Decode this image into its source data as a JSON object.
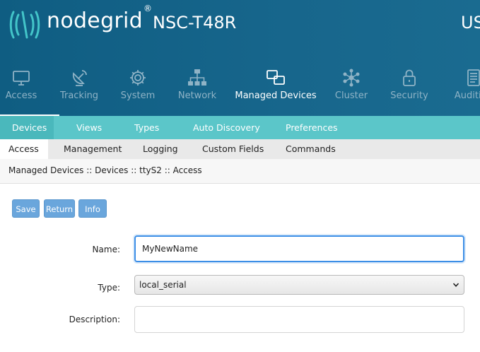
{
  "header": {
    "brand": "nodegrid",
    "registered": "®",
    "model": "NSC-T48R",
    "user": "US"
  },
  "main_nav": [
    {
      "label": "Access",
      "icon": "monitor-icon",
      "active": false
    },
    {
      "label": "Tracking",
      "icon": "satellite-dish-icon",
      "active": false
    },
    {
      "label": "System",
      "icon": "gear-icon",
      "active": false
    },
    {
      "label": "Network",
      "icon": "network-tree-icon",
      "active": false
    },
    {
      "label": "Managed Devices",
      "icon": "devices-icon",
      "active": true
    },
    {
      "label": "Cluster",
      "icon": "cluster-icon",
      "active": false
    },
    {
      "label": "Security",
      "icon": "lock-icon",
      "active": false
    },
    {
      "label": "Auditing",
      "icon": "document-icon",
      "active": false
    }
  ],
  "sub_nav": [
    {
      "label": "Devices",
      "active": true
    },
    {
      "label": "Views",
      "active": false
    },
    {
      "label": "Types",
      "active": false
    },
    {
      "label": "Auto Discovery",
      "active": false
    },
    {
      "label": "Preferences",
      "active": false
    }
  ],
  "tabs": [
    {
      "label": "Access",
      "active": true
    },
    {
      "label": "Management",
      "active": false
    },
    {
      "label": "Logging",
      "active": false
    },
    {
      "label": "Custom Fields",
      "active": false
    },
    {
      "label": "Commands",
      "active": false
    }
  ],
  "breadcrumb": "Managed Devices :: Devices :: ttyS2 :: Access",
  "buttons": {
    "save": "Save",
    "return": "Return",
    "info": "Info"
  },
  "form": {
    "name_label": "Name:",
    "name_value": "MyNewName",
    "type_label": "Type:",
    "type_value": "local_serial",
    "description_label": "Description:",
    "description_value": ""
  },
  "colors": {
    "header_bg": "#17668c",
    "sub_nav_bg": "#5bc6c9",
    "button_bg": "#6aa6dc",
    "focus_border": "#3c8ee6"
  }
}
